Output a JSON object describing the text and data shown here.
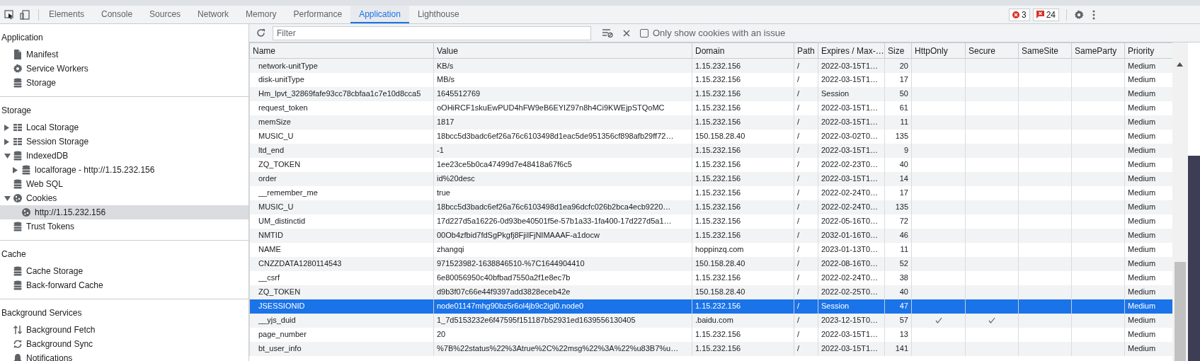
{
  "tabs": [
    {
      "label": "Elements",
      "selected": false
    },
    {
      "label": "Console",
      "selected": false
    },
    {
      "label": "Sources",
      "selected": false
    },
    {
      "label": "Network",
      "selected": false
    },
    {
      "label": "Memory",
      "selected": false
    },
    {
      "label": "Performance",
      "selected": false
    },
    {
      "label": "Application",
      "selected": true
    },
    {
      "label": "Lighthouse",
      "selected": false
    }
  ],
  "counters": {
    "errors": "3",
    "issues": "24"
  },
  "sidebar": [
    {
      "title": "Application",
      "items": [
        {
          "label": "Manifest",
          "kind": "file",
          "selected": false
        },
        {
          "label": "Service Workers",
          "kind": "gear",
          "selected": false
        },
        {
          "label": "Storage",
          "kind": "database",
          "selected": false
        }
      ]
    },
    {
      "title": "Storage",
      "items": [
        {
          "label": "Local Storage",
          "kind": "table",
          "expanded": false,
          "selected": false
        },
        {
          "label": "Session Storage",
          "kind": "table",
          "expanded": false,
          "selected": false
        },
        {
          "label": "IndexedDB",
          "kind": "database",
          "expanded": true,
          "selected": false,
          "children": [
            {
              "label": "localforage - http://1.15.232.156",
              "kind": "database",
              "expanded": false,
              "selected": false
            }
          ]
        },
        {
          "label": "Web SQL",
          "kind": "database",
          "selected": false
        },
        {
          "label": "Cookies",
          "kind": "cookie",
          "expanded": true,
          "selected": false,
          "children": [
            {
              "label": "http://1.15.232.156",
              "kind": "cookie",
              "selected": true
            }
          ]
        },
        {
          "label": "Trust Tokens",
          "kind": "database",
          "selected": false
        }
      ]
    },
    {
      "title": "Cache",
      "items": [
        {
          "label": "Cache Storage",
          "kind": "database",
          "selected": false
        },
        {
          "label": "Back-forward Cache",
          "kind": "database",
          "selected": false
        }
      ]
    },
    {
      "title": "Background Services",
      "items": [
        {
          "label": "Background Fetch",
          "kind": "updown",
          "selected": false
        },
        {
          "label": "Background Sync",
          "kind": "sync",
          "selected": false
        },
        {
          "label": "Notifications",
          "kind": "bell",
          "selected": false
        }
      ]
    }
  ],
  "toolbar": {
    "filter_placeholder": "Filter",
    "issue_only": {
      "label": "Only show cookies with an issue",
      "checked": false
    }
  },
  "table": {
    "columns": [
      "Name",
      "Value",
      "Domain",
      "Path",
      "Expires / Max-…",
      "Size",
      "HttpOnly",
      "Secure",
      "SameSite",
      "SameParty",
      "Priority"
    ],
    "rows": [
      {
        "name": "network-unitType",
        "value": "KB/s",
        "domain": "1.15.232.156",
        "path": "/",
        "expires": "2022-03-15T1…",
        "size": "20",
        "http_only": false,
        "secure": false,
        "priority": "Medium",
        "selected": false
      },
      {
        "name": "disk-unitType",
        "value": "MB/s",
        "domain": "1.15.232.156",
        "path": "/",
        "expires": "2022-03-15T1…",
        "size": "17",
        "http_only": false,
        "secure": false,
        "priority": "Medium",
        "selected": false
      },
      {
        "name": "Hm_lpvt_32869fafe93cc78cbfaa1c7e10d8cca5",
        "value": "1645512769",
        "domain": "1.15.232.156",
        "path": "/",
        "expires": "Session",
        "size": "50",
        "http_only": false,
        "secure": false,
        "priority": "Medium",
        "selected": false
      },
      {
        "name": "request_token",
        "value": "oOHiRCF1skuEwPUD4hFW9eB6EYIZ97n8h4Ci9KWEjpSTQoMC",
        "domain": "1.15.232.156",
        "path": "/",
        "expires": "2022-03-15T1…",
        "size": "61",
        "http_only": false,
        "secure": false,
        "priority": "Medium",
        "selected": false
      },
      {
        "name": "memSize",
        "value": "1817",
        "domain": "1.15.232.156",
        "path": "/",
        "expires": "2022-03-15T1…",
        "size": "11",
        "http_only": false,
        "secure": false,
        "priority": "Medium",
        "selected": false
      },
      {
        "name": "MUSIC_U",
        "value": "18bcc5d3badc6ef26a76c6103498d1eac5de951356cf898afb29ff72…",
        "domain": "150.158.28.40",
        "path": "/",
        "expires": "2022-03-02T0…",
        "size": "135",
        "http_only": false,
        "secure": false,
        "priority": "Medium",
        "selected": false
      },
      {
        "name": "ltd_end",
        "value": "-1",
        "domain": "1.15.232.156",
        "path": "/",
        "expires": "2022-03-15T1…",
        "size": "9",
        "http_only": false,
        "secure": false,
        "priority": "Medium",
        "selected": false
      },
      {
        "name": "ZQ_TOKEN",
        "value": "1ee23ce5b0ca47499d7e48418a67f6c5",
        "domain": "1.15.232.156",
        "path": "/",
        "expires": "2022-02-23T0…",
        "size": "40",
        "http_only": false,
        "secure": false,
        "priority": "Medium",
        "selected": false
      },
      {
        "name": "order",
        "value": "id%20desc",
        "domain": "1.15.232.156",
        "path": "/",
        "expires": "2022-03-15T1…",
        "size": "14",
        "http_only": false,
        "secure": false,
        "priority": "Medium",
        "selected": false
      },
      {
        "name": "__remember_me",
        "value": "true",
        "domain": "1.15.232.156",
        "path": "/",
        "expires": "2022-02-24T0…",
        "size": "17",
        "http_only": false,
        "secure": false,
        "priority": "Medium",
        "selected": false
      },
      {
        "name": "MUSIC_U",
        "value": "18bcc5d3badc6ef26a76c6103498d1ea96dcfc026b2bca4ecb9220…",
        "domain": "1.15.232.156",
        "path": "/",
        "expires": "2022-02-24T0…",
        "size": "135",
        "http_only": false,
        "secure": false,
        "priority": "Medium",
        "selected": false
      },
      {
        "name": "UM_distinctid",
        "value": "17d227d5a16226-0d93be40501f5e-57b1a33-1fa400-17d227d5a1…",
        "domain": "1.15.232.156",
        "path": "/",
        "expires": "2022-05-16T0…",
        "size": "72",
        "http_only": false,
        "secure": false,
        "priority": "Medium",
        "selected": false
      },
      {
        "name": "NMTID",
        "value": "00Ob4zfbid7fdSgPkgfj8FjiIFjNIMAAAF-a1docw",
        "domain": "1.15.232.156",
        "path": "/",
        "expires": "2032-01-16T0…",
        "size": "46",
        "http_only": false,
        "secure": false,
        "priority": "Medium",
        "selected": false
      },
      {
        "name": "NAME",
        "value": "zhangqi",
        "domain": "hoppinzq.com",
        "path": "/",
        "expires": "2023-01-13T0…",
        "size": "11",
        "http_only": false,
        "secure": false,
        "priority": "Medium",
        "selected": false
      },
      {
        "name": "CNZZDATA1280114543",
        "value": "971523982-1638846510-%7C1644904410",
        "domain": "150.158.28.40",
        "path": "/",
        "expires": "2022-08-16T0…",
        "size": "52",
        "http_only": false,
        "secure": false,
        "priority": "Medium",
        "selected": false
      },
      {
        "name": "__csrf",
        "value": "6e80056950c40bfbad7550a2f1e8ec7b",
        "domain": "1.15.232.156",
        "path": "/",
        "expires": "2022-02-24T0…",
        "size": "38",
        "http_only": false,
        "secure": false,
        "priority": "Medium",
        "selected": false
      },
      {
        "name": "ZQ_TOKEN",
        "value": "d9b3f07c66e44f9397add3828eceb42e",
        "domain": "150.158.28.40",
        "path": "/",
        "expires": "2022-02-25T0…",
        "size": "40",
        "http_only": false,
        "secure": false,
        "priority": "Medium",
        "selected": false
      },
      {
        "name": "JSESSIONID",
        "value": "node01147mhg90bz5r6ol4jb9c2igl0.node0",
        "domain": "1.15.232.156",
        "path": "/",
        "expires": "Session",
        "size": "47",
        "http_only": false,
        "secure": false,
        "priority": "Medium",
        "selected": true
      },
      {
        "name": "__yjs_duid",
        "value": "1_7d5153232e6f47595f151187b52931ed1639556130405",
        "domain": ".baidu.com",
        "path": "/",
        "expires": "2023-12-15T0…",
        "size": "57",
        "http_only": true,
        "secure": true,
        "priority": "Medium",
        "selected": false
      },
      {
        "name": "page_number",
        "value": "20",
        "domain": "1.15.232.156",
        "path": "/",
        "expires": "2022-03-15T1…",
        "size": "13",
        "http_only": false,
        "secure": false,
        "priority": "Medium",
        "selected": false
      },
      {
        "name": "bt_user_info",
        "value": "%7B%22status%22%3Atrue%2C%22msg%22%3A%22%u83B7%u…",
        "domain": "1.15.232.156",
        "path": "/",
        "expires": "2022-03-15T1…",
        "size": "141",
        "http_only": false,
        "secure": false,
        "priority": "Medium",
        "selected": false
      }
    ]
  }
}
